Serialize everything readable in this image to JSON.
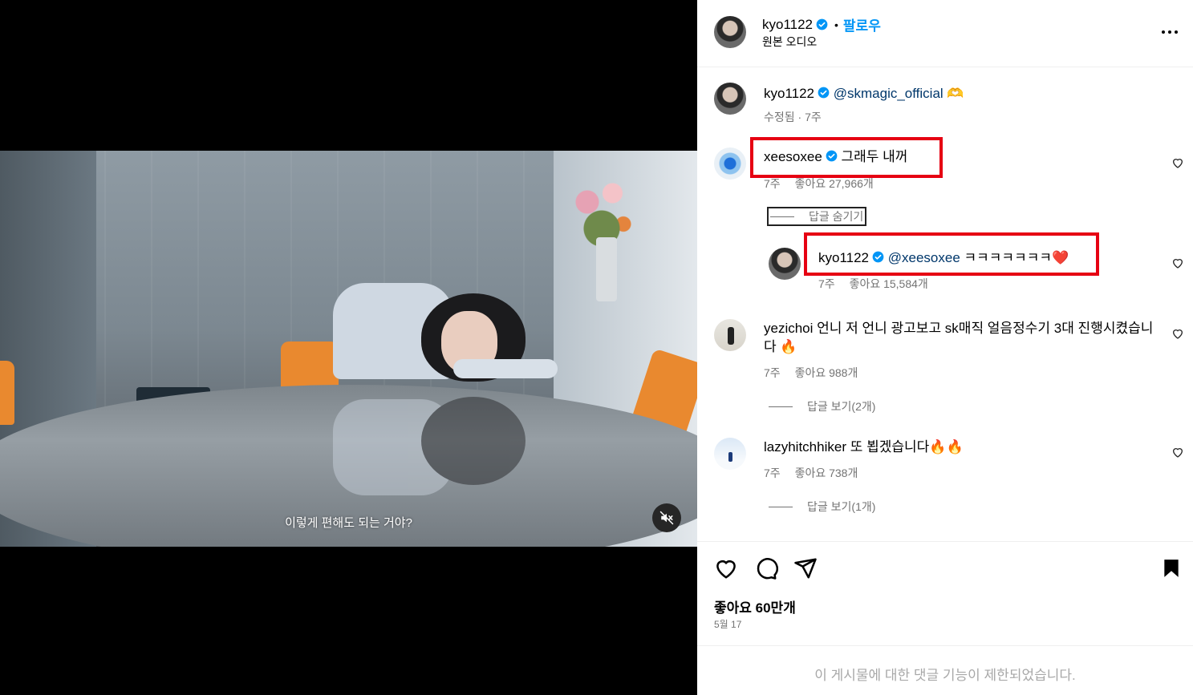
{
  "video": {
    "subtitle": "이렇게 편해도 되는 거야?",
    "mute_icon": "speaker-muted-icon"
  },
  "header": {
    "username": "kyo1122",
    "follow_label": "팔로우",
    "audio_label": "원본 오디오",
    "more_icon": "more-options-icon"
  },
  "caption": {
    "username": "kyo1122",
    "text": "@skmagic_official 🫶",
    "edited_label": "수정됨",
    "time": "7주",
    "meta": "수정됨 · 7주"
  },
  "comments": [
    {
      "username": "xeesoxee",
      "verified": true,
      "text": "그래두 내꺼",
      "time": "7주",
      "likes": "좋아요 27,966개",
      "replies_toggle": "답글 숨기기",
      "reply": {
        "username": "kyo1122",
        "verified": true,
        "mention": "@xeesoxee",
        "text": "ㅋㅋㅋㅋㅋㅋㅋ❤️",
        "time": "7주",
        "likes": "좋아요 15,584개"
      }
    },
    {
      "username": "yezichoi",
      "verified": false,
      "text": "언니 저 언니 광고보고 sk매직 얼음정수기 3대 진행시켰습니다 🔥",
      "time": "7주",
      "likes": "좋아요 988개",
      "replies_toggle": "답글 보기(2개)"
    },
    {
      "username": "lazyhitchhiker",
      "verified": false,
      "text": "또 뵙겠습니다🔥🔥",
      "time": "7주",
      "likes": "좋아요 738개",
      "replies_toggle": "답글 보기(1개)"
    }
  ],
  "actions": {
    "like_icon": "heart-icon",
    "comment_icon": "comment-icon",
    "share_icon": "share-icon",
    "save_icon": "bookmark-icon"
  },
  "footer": {
    "likes_label": "좋아요 60만개",
    "date": "5월 17",
    "comments_disabled": "이 게시물에 대한 댓글 기능이 제한되었습니다."
  },
  "colors": {
    "accent": "#0095f6",
    "verified": "#0095f6",
    "highlight": "#e60012",
    "muted_text": "#737373"
  }
}
